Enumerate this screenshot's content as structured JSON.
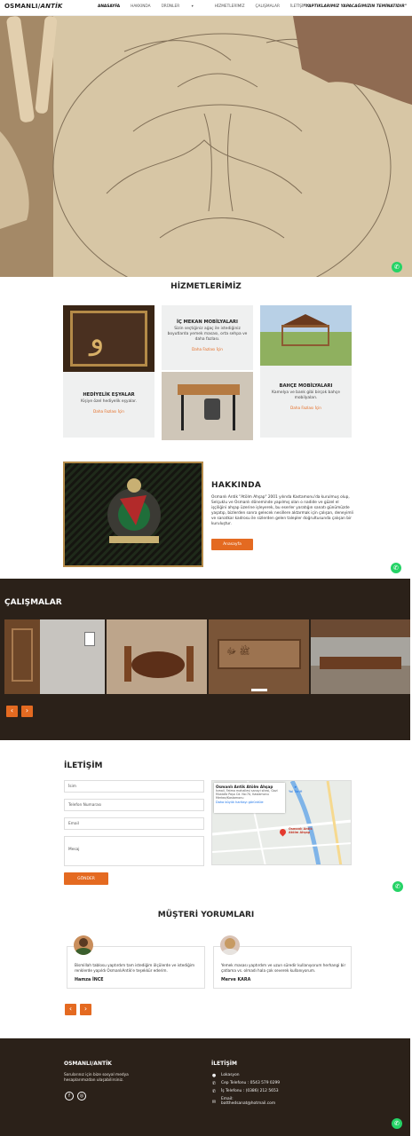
{
  "header": {
    "logo_main": "OSMANLI/",
    "logo_italic": "ANTİK",
    "nav": [
      "ANASAYFA",
      "HAKKINDA",
      "ÜRÜNLER",
      "HİZMETLERİMİZ",
      "ÇALIŞMALAR",
      "İLETİŞİM"
    ],
    "nav_dropdown_icon": "chevron-down-icon",
    "tagline": "\"YAPTIKLARIMIZ YAPACAĞIMIZIN TEMİNATIDIR\""
  },
  "services": {
    "title": "HİZMETLERİMİZ",
    "items": [
      {
        "name": "HEDİYELİK EŞYALAR",
        "desc": "Kişiye özel hediyelik eşyalar.",
        "link": "Daha Fazlası İçin"
      },
      {
        "name": "İÇ MEKAN MOBİLYALARI",
        "desc": "Sizin seçtiğiniz ağaç ile istediğiniz boyutlarda yemek masası, orta sehpa ve daha fazlası.",
        "link": "Daha Fazlası İçin"
      },
      {
        "name": "BAHÇE MOBİLYALARI",
        "desc": "Kamelya ve bank gibi birçok bahçe mobilyaları.",
        "link": "Daha Fazlası İçin"
      }
    ]
  },
  "about": {
    "title": "HAKKINDA",
    "text": "Osmanlı Antik \"Atölm Ahşap\" 2001 yılında Kastamonu'da kurulmuş olup, Selçuklu ve Osmanlı döneminde yapılmış olan o nadide ve güzel el işçiliğini ahşap üzerine işleyerek, bu eserler yaratığın sanatı günümüzde yaşatıp, bizlerden sonra gelecek nesillere aktarmak için çalışan, deneyimli ve sanatkar kadrosu ile sizlerden gelen talepler doğrultusunda çalışan bir kuruluştur.",
    "button": "Anasayfa"
  },
  "works": {
    "title": "ÇALIŞMALAR",
    "prev": "‹",
    "next": "›"
  },
  "contact": {
    "title": "İLETİŞİM",
    "fields": {
      "name": "İsim",
      "phone": "Telefon Numarası",
      "email": "Email",
      "message": "Mesaj"
    },
    "submit": "GÖNDER",
    "map": {
      "place": "Osmanlı Antik Atölm Ahşap",
      "address": "İsmail, Fatma mahallesi sanayi sitesi, Gazi Mustafa Paşa Cd. No:70, Kastamonu Merkez/Kastamonu",
      "directions": "Yol Tarifi",
      "larger": "Daha büyük haritayı görüntüle",
      "pin_label": "Osmanlı Antik Atölm Ahşap"
    }
  },
  "reviews": {
    "title": "MÜŞTERİ YORUMLARI",
    "items": [
      {
        "text": "Bismillah tablosu yaptırdım tam istediğim ölçülerde ve istediğim renklerde yapıldı OsmanlıAntik'e teşekkür ederim.",
        "name": "Hamza İNCE"
      },
      {
        "text": "Yemek masası yaptırdım ve uzun süredir kullanıyorum herhangi bir çatlama vs. olmadı hala çok severek kullanıyorum.",
        "name": "Merve KARA"
      }
    ],
    "prev": "‹",
    "next": "›"
  },
  "footer": {
    "brand": "OSMANLI/ANTİK",
    "text": "Sorularınız için bize sosyal medya hesaplarımızdan ulaşabilirsiniz.",
    "contact_title": "İLETİŞİM",
    "location": "Lokasyon",
    "mobile": "Cep Telefonu : 0543 579 0299",
    "work_phone": "İş Telefonu : (0386) 212 5653",
    "email_label": "Email:",
    "email": "batthedsanat@hotmail.com"
  },
  "colors": {
    "accent": "#e46a21",
    "dark": "#2b2119",
    "whatsapp": "#25d366"
  }
}
